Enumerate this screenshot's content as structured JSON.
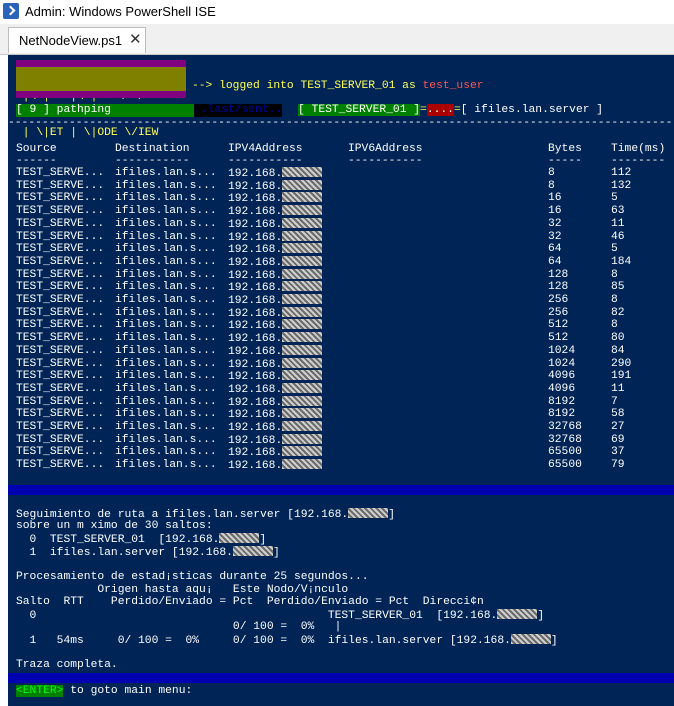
{
  "window": {
    "title": "Admin: Windows PowerShell ISE",
    "icon": "powershell-icon"
  },
  "tabs": [
    {
      "label": "NetNodeView.ps1",
      "close": "✕"
    }
  ],
  "banner": {
    "logo_line1": " |\\ |   |\\ |   \\  /",
    "logo_line2": " | \\|ET | \\|ODE \\/IEW",
    "arrow_text": "--> logged into ",
    "server": "TEST_SERVER_01",
    "as_text": " as ",
    "user": "test_user"
  },
  "status_line": {
    "menu_item": "[ 9 ] pathping",
    "path": "..last/sent..",
    "server_box": "[ TEST_SERVER_01 ]",
    "eq1": "=",
    "dots": "....",
    "eq2": "=",
    "target_box": "[ ifiles.lan.server ]"
  },
  "rule_line": "------------------------------------------------------------------------------------------------------",
  "table": {
    "headers": [
      "Source",
      "Destination",
      "IPV4Address",
      "IPV6Address",
      "Bytes",
      "Time(ms)"
    ],
    "underlines": [
      "------",
      "-----------",
      "-----------",
      "-----------",
      "-----",
      "--------"
    ],
    "source": "TEST_SERVE...",
    "destination": "ifiles.lan.s...",
    "ipv4_prefix": "192.168.",
    "rows": [
      {
        "bytes": "8",
        "time": "112"
      },
      {
        "bytes": "8",
        "time": "132"
      },
      {
        "bytes": "16",
        "time": "5"
      },
      {
        "bytes": "16",
        "time": "63"
      },
      {
        "bytes": "32",
        "time": "11"
      },
      {
        "bytes": "32",
        "time": "46"
      },
      {
        "bytes": "64",
        "time": "5"
      },
      {
        "bytes": "64",
        "time": "184"
      },
      {
        "bytes": "128",
        "time": "8"
      },
      {
        "bytes": "128",
        "time": "85"
      },
      {
        "bytes": "256",
        "time": "8"
      },
      {
        "bytes": "256",
        "time": "82"
      },
      {
        "bytes": "512",
        "time": "8"
      },
      {
        "bytes": "512",
        "time": "80"
      },
      {
        "bytes": "1024",
        "time": "84"
      },
      {
        "bytes": "1024",
        "time": "290"
      },
      {
        "bytes": "4096",
        "time": "191"
      },
      {
        "bytes": "4096",
        "time": "11"
      },
      {
        "bytes": "8192",
        "time": "7"
      },
      {
        "bytes": "8192",
        "time": "58"
      },
      {
        "bytes": "32768",
        "time": "27"
      },
      {
        "bytes": "32768",
        "time": "69"
      },
      {
        "bytes": "65500",
        "time": "37"
      },
      {
        "bytes": "65500",
        "time": "79"
      }
    ]
  },
  "trace": {
    "line1": "Seguimiento de ruta a ifiles.lan.server [192.168.",
    "line1_end": "]",
    "line2": "sobre un m ximo de 30 saltos:",
    "hop0": "  0  TEST_SERVER_01  [192.168.",
    "hop0_end": "]",
    "hop1": "  1  ifiles.lan.server [192.168.",
    "hop1_end": "]",
    "proc": "Procesamiento de estad¡sticas durante 25 segundos...",
    "hdr1": "            Origen hasta aqu¡   Este Nodo/V¡nculo",
    "hdr2": "Salto  RTT    Perdido/Enviado = Pct  Perdido/Enviado = Pct  Direcci¢n",
    "r0a": "  0                                           TEST_SERVER_01  [192.168.",
    "r0a_end": "]",
    "r0b": "                                0/ 100 =  0%   |",
    "r1": "  1   54ms     0/ 100 =  0%     0/ 100 =  0%  ifiles.lan.server [192.168.",
    "r1_end": "]",
    "done": "Traza completa."
  },
  "prompt": {
    "key": "<ENTER>",
    "text": " to goto main menu:"
  },
  "colors": {
    "console_bg": "#012456",
    "logo_band": "#800080",
    "logo_bg": "#808000",
    "green": "#00ff00",
    "yellow": "#ffff55",
    "red": "#ff5555",
    "separator": "#0000b0"
  }
}
